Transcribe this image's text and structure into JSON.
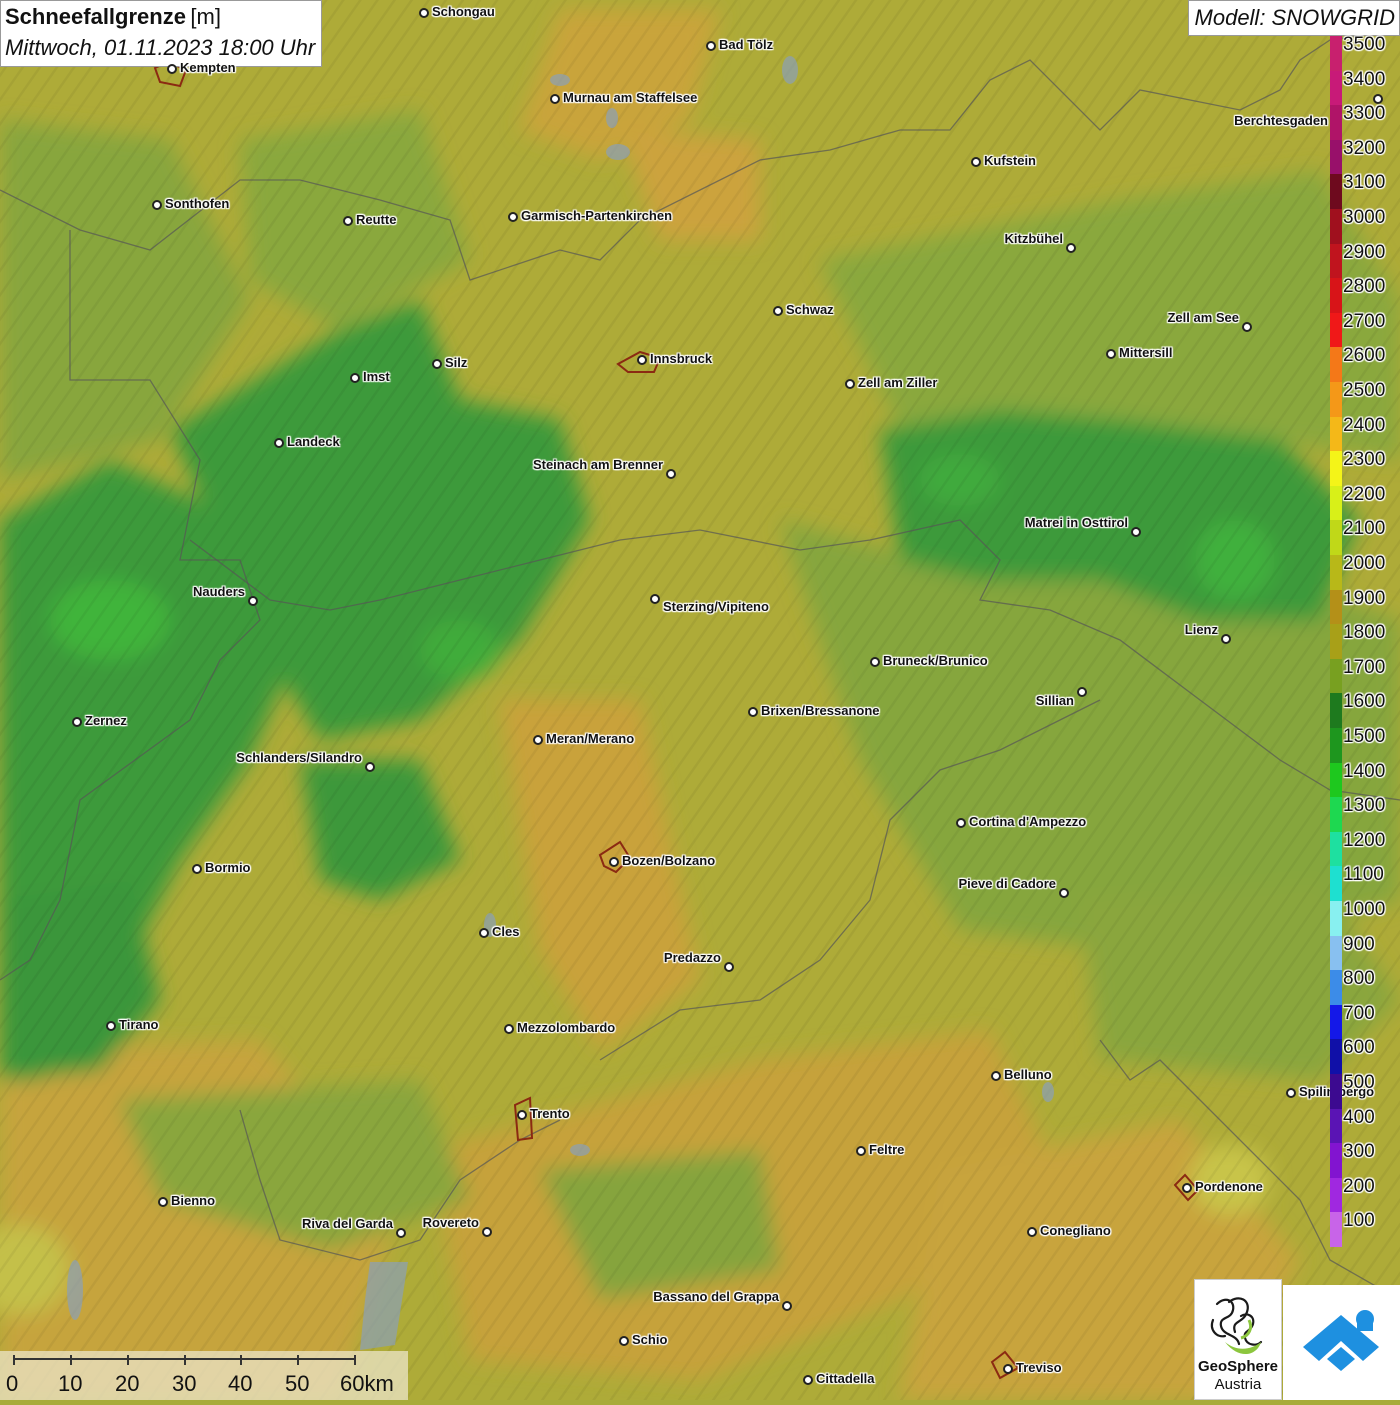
{
  "title": {
    "main": "Schneefallgrenze",
    "unit": "[m]",
    "subtitle": "Mittwoch, 01.11.2023 18:00 Uhr"
  },
  "model": "Modell: SNOWGRID",
  "cities": [
    {
      "name": "Schongau"
    },
    {
      "name": "Bad Tölz"
    },
    {
      "name": "Kempten"
    },
    {
      "name": "Murnau am Staffelsee"
    },
    {
      "name": "Berchtesgaden"
    },
    {
      "name": "Kufstein"
    },
    {
      "name": "Sonthofen"
    },
    {
      "name": "Reutte"
    },
    {
      "name": "Garmisch-Partenkirchen"
    },
    {
      "name": "Kitzbühel"
    },
    {
      "name": "Schwaz"
    },
    {
      "name": "Zell am See"
    },
    {
      "name": "Mittersill"
    },
    {
      "name": "Innsbruck"
    },
    {
      "name": "Imst"
    },
    {
      "name": "Silz"
    },
    {
      "name": "Zell am Ziller"
    },
    {
      "name": "Landeck"
    },
    {
      "name": "Steinach am Brenner"
    },
    {
      "name": "Matrei in Osttirol"
    },
    {
      "name": "Nauders"
    },
    {
      "name": "Sterzing/Vipiteno"
    },
    {
      "name": "Lienz"
    },
    {
      "name": "Bruneck/Brunico"
    },
    {
      "name": "Sillian"
    },
    {
      "name": "Zernez"
    },
    {
      "name": "Brixen/Bressanone"
    },
    {
      "name": "Meran/Merano"
    },
    {
      "name": "Schlanders/Silandro"
    },
    {
      "name": "Cortina d'Ampezzo"
    },
    {
      "name": "Bozen/Bolzano"
    },
    {
      "name": "Bormio"
    },
    {
      "name": "Pieve di Cadore"
    },
    {
      "name": "Cles"
    },
    {
      "name": "Predazzo"
    },
    {
      "name": "Tirano"
    },
    {
      "name": "Mezzolombardo"
    },
    {
      "name": "Belluno"
    },
    {
      "name": "Spilimbergo"
    },
    {
      "name": "Trento"
    },
    {
      "name": "Feltre"
    },
    {
      "name": "Pordenone"
    },
    {
      "name": "Bienno"
    },
    {
      "name": "Riva del Garda"
    },
    {
      "name": "Rovereto"
    },
    {
      "name": "Conegliano"
    },
    {
      "name": "Bassano del Grappa"
    },
    {
      "name": "Schio"
    },
    {
      "name": "Treviso"
    },
    {
      "name": "Cittadella"
    }
  ],
  "legend": {
    "levels": [
      "3500",
      "3400",
      "3300",
      "3200",
      "3100",
      "3000",
      "2900",
      "2800",
      "2700",
      "2600",
      "2500",
      "2400",
      "2300",
      "2200",
      "2100",
      "2000",
      "1900",
      "1800",
      "1700",
      "1600",
      "1500",
      "1400",
      "1300",
      "1200",
      "1100",
      "1000",
      "900",
      "800",
      "700",
      "600",
      "500",
      "400",
      "300",
      "200",
      "100"
    ],
    "colors": [
      "#c8206e",
      "#c81a78",
      "#b01468",
      "#98106a",
      "#6e0a1e",
      "#a0101e",
      "#c0141e",
      "#d81418",
      "#f01818",
      "#f47818",
      "#f49818",
      "#f4b818",
      "#f4f418",
      "#d8f018",
      "#c0d818",
      "#b8b818",
      "#b49018",
      "#a8a018",
      "#78a020",
      "#1e7a1e",
      "#1e961e",
      "#1ec81e",
      "#1ed850",
      "#1ee0a0",
      "#1ee0d0",
      "#88f0f0",
      "#88c0f0",
      "#3c8ce8",
      "#1418e8",
      "#1010a8",
      "#3c0a90",
      "#5a14b4",
      "#8214d0",
      "#a028e0",
      "#c864e8"
    ]
  },
  "scale": {
    "ticks": [
      "0",
      "10",
      "20",
      "30",
      "40",
      "50",
      "60km"
    ]
  },
  "logo": {
    "line1": "GeoSphere",
    "line2": "Austria"
  },
  "colors": {
    "terrain_yellow": "#b4a632",
    "terrain_orange": "#c8a63a",
    "terrain_green": "#86a63c",
    "terrain_dark_green": "#3c9a3a"
  }
}
